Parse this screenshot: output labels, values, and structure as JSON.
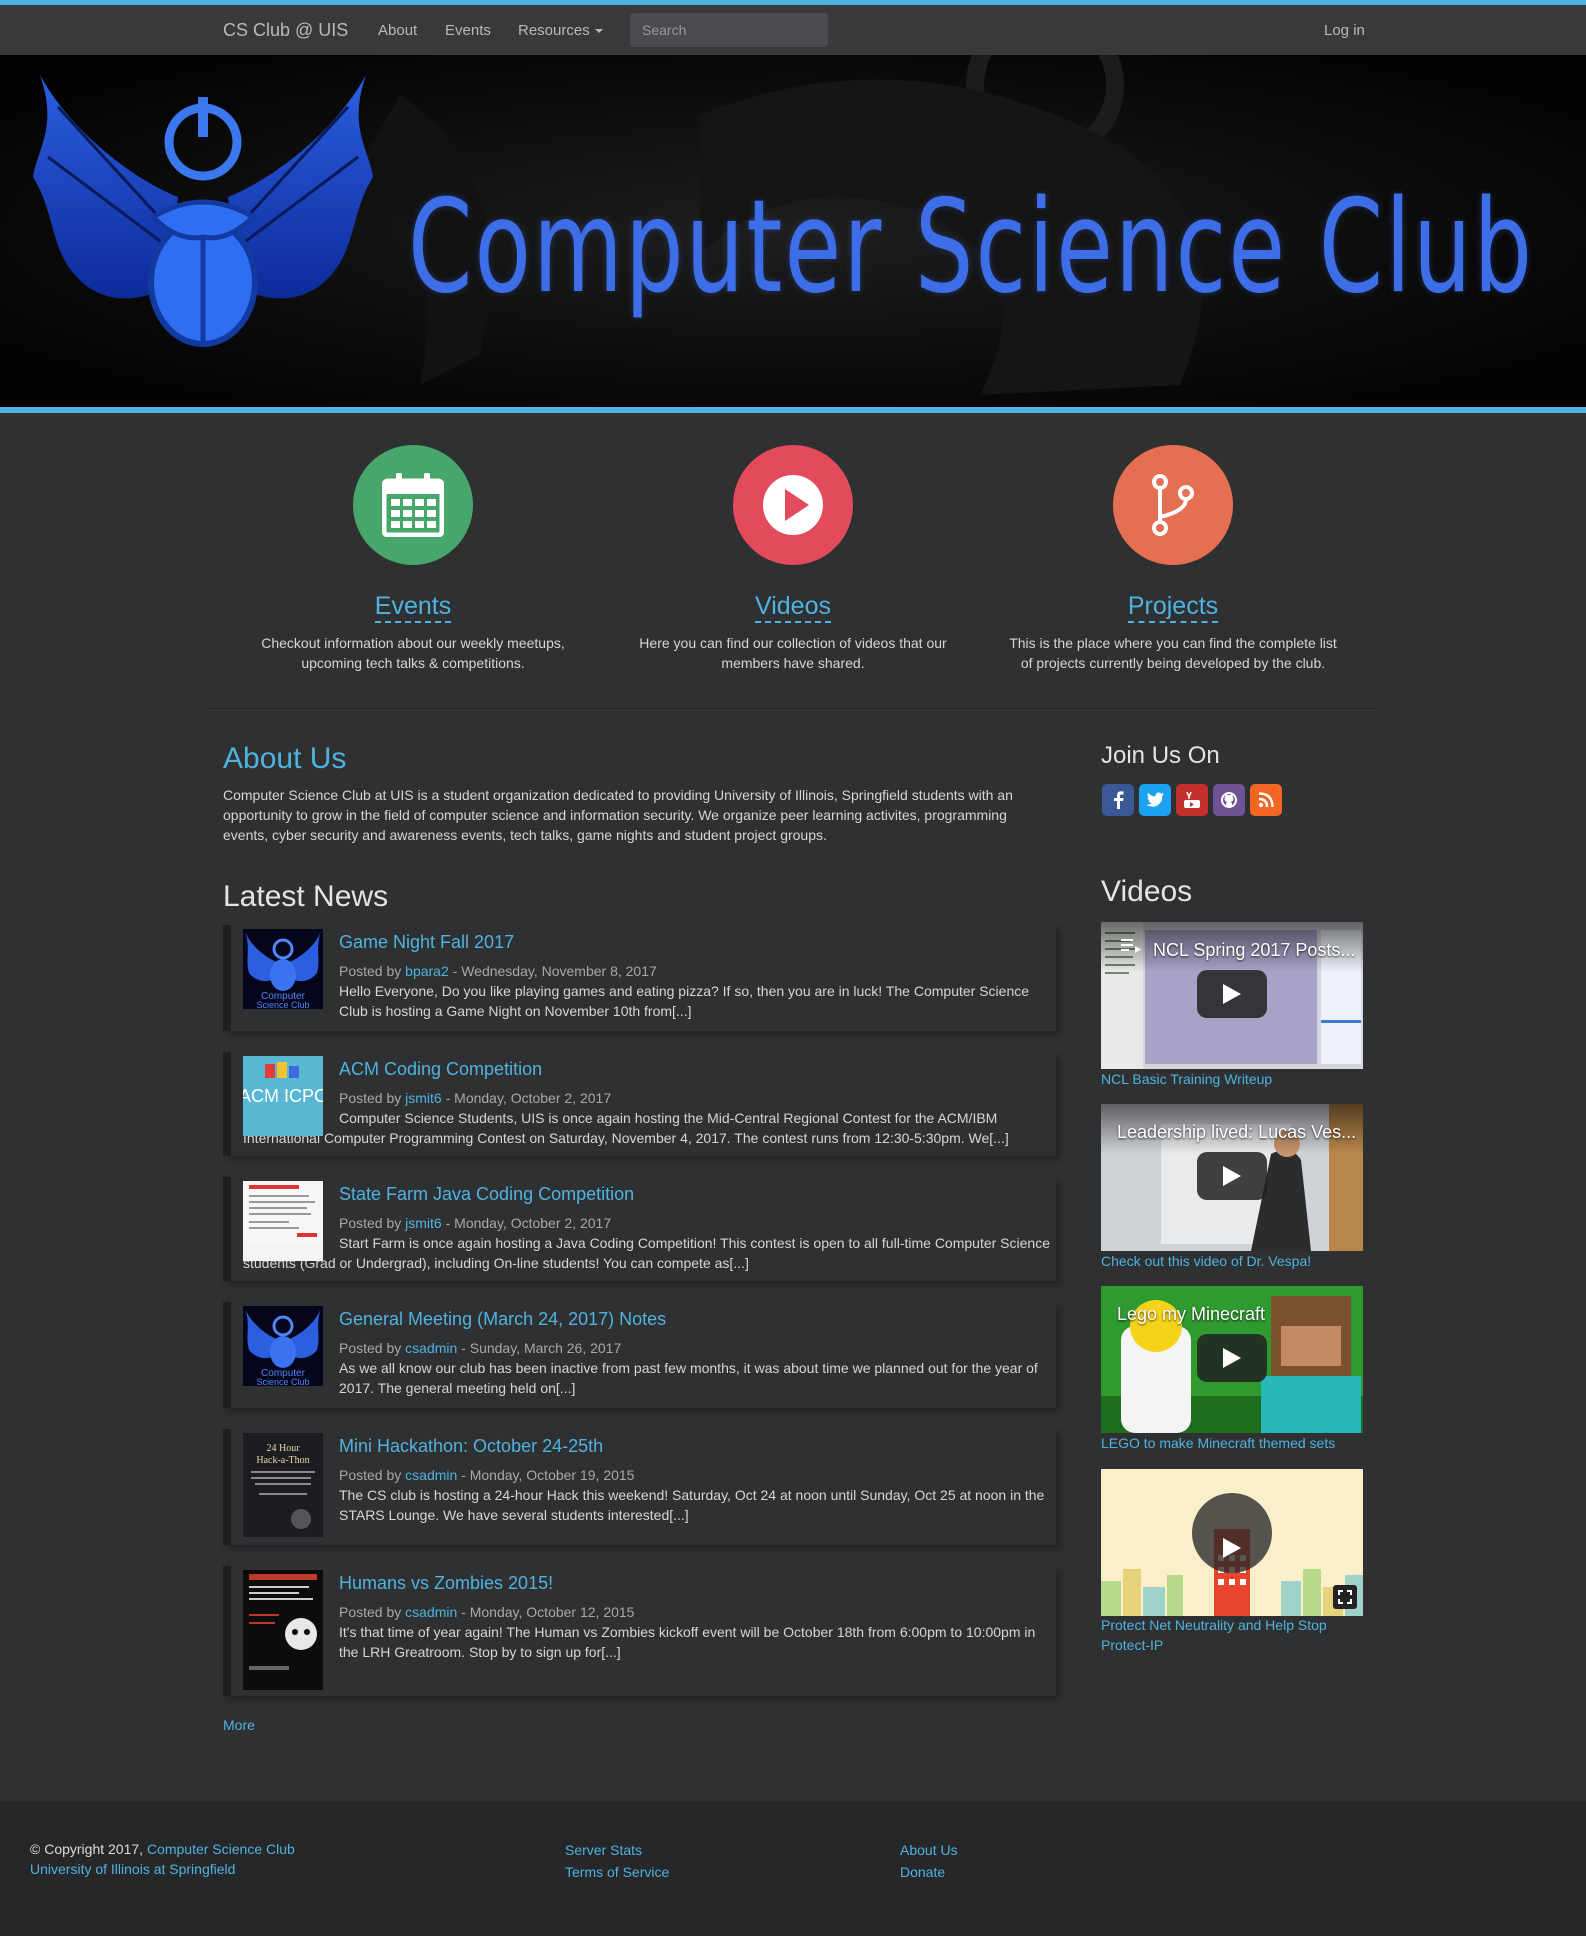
{
  "nav": {
    "brand": "CS Club @ UIS",
    "about": "About",
    "events": "Events",
    "resources": "Resources",
    "search_placeholder": "Search",
    "login": "Log in"
  },
  "banner": {
    "title": "Computer Science Club"
  },
  "features": [
    {
      "title": "Events",
      "desc": "Checkout information about our weekly meetups, upcoming tech talks & competitions.",
      "icon": "calendar-icon",
      "color": "#47a66a"
    },
    {
      "title": "Videos",
      "desc": "Here you can find our collection of videos that our members have shared.",
      "icon": "play-icon",
      "color": "#e34a5c"
    },
    {
      "title": "Projects",
      "desc": "This is the place where you can find the complete list of projects currently being developed by the club.",
      "icon": "branch-icon",
      "color": "#e46f52"
    }
  ],
  "about": {
    "title": "About Us",
    "text": "Computer Science Club at UIS is a student organization dedicated to providing University of Illinois, Springfield students with an opportunity to grow in the field of computer science and information security. We organize peer learning activites, programming events, cyber security and awareness events, tech talks, game nights and student project groups."
  },
  "news": {
    "title": "Latest News",
    "posted_by": "Posted by",
    "items": [
      {
        "title": "Game Night Fall 2017",
        "author": "bpara2",
        "date": " - Wednesday, November 8, 2017",
        "text": "Hello Everyone, Do you like playing games and eating pizza? If so, then you are in luck! The Computer Science Club is hosting a Game Night on November 10th from[...]"
      },
      {
        "title": "ACM Coding Competition",
        "author": "jsmit6",
        "date": " - Monday, October 2, 2017",
        "text": "Computer Science Students, UIS is once again hosting the Mid-Central Regional Contest for the ACM/IBM International Computer Programming Contest on Saturday, November 4, 2017. The contest runs from 12:30-5:30pm. We[...]"
      },
      {
        "title": "State Farm Java Coding Competition",
        "author": "jsmit6",
        "date": " - Monday, October 2, 2017",
        "text": "Start Farm is once again hosting a Java Coding Competition! This contest is open to all full-time Computer Science students (Grad or Undergrad), including On-line students! You can compete as[...]"
      },
      {
        "title": "General Meeting (March 24, 2017) Notes",
        "author": "csadmin",
        "date": " - Sunday, March 26, 2017",
        "text": "As we all know our club has been inactive from past few months, it was about time we planned out for the year of 2017. The general meeting held on[...]"
      },
      {
        "title": "Mini Hackathon: October 24-25th",
        "author": "csadmin",
        "date": " - Monday, October 19, 2015",
        "text": "The CS club is hosting a 24-hour Hack this weekend! Saturday, Oct 24 at noon until Sunday, Oct 25 at noon in the STARS Lounge. We have several students interested[...]"
      },
      {
        "title": "Humans vs Zombies 2015!",
        "author": "csadmin",
        "date": " - Monday, October 12, 2015",
        "text": "It's that time of year again! The Human vs Zombies kickoff event will be October 18th from 6:00pm to 10:00pm in the LRH Greatroom. Stop by to sign up for[...]"
      }
    ],
    "more": "More",
    "thumb_acm_label": "ACM ICPC",
    "thumb_club_label_1": "Computer",
    "thumb_club_label_2": "Science Club",
    "thumb_hack_label_1": "24 Hour",
    "thumb_hack_label_2": "Hack-a-Thon"
  },
  "sidebar": {
    "join_title": "Join Us On",
    "social": [
      {
        "icon": "facebook-icon",
        "color": "#3b5998"
      },
      {
        "icon": "twitter-icon",
        "color": "#1da1f2"
      },
      {
        "icon": "youtube-icon",
        "color": "#c4302b"
      },
      {
        "icon": "github-icon",
        "color": "#6e5494"
      },
      {
        "icon": "rss-icon",
        "color": "#f26522"
      }
    ],
    "videos_title": "Videos",
    "videos": [
      {
        "title": "NCL Spring 2017 Posts...",
        "caption": "NCL Basic Training Writeup"
      },
      {
        "title": "Leadership lived: Lucas Ves...",
        "caption": "Check out this video of Dr. Vespa!"
      },
      {
        "title": "Lego my Minecraft",
        "caption": "LEGO to make Minecraft themed sets"
      },
      {
        "title": "",
        "caption": "Protect Net Neutrality and Help Stop Protect-IP"
      }
    ]
  },
  "footer": {
    "copyright": "© Copyright 2017, ",
    "club_link": "Computer Science Club",
    "university": "University of Illinois at Springfield",
    "server_stats": "Server Stats",
    "terms": "Terms of Service",
    "about_us": "About Us",
    "donate": "Donate"
  }
}
